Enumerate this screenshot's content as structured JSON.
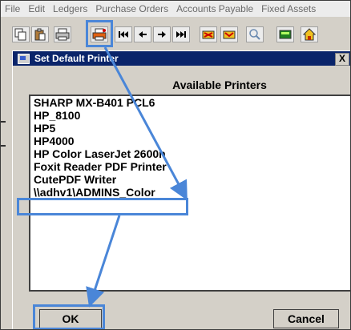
{
  "menu": {
    "items": [
      "File",
      "Edit",
      "Ledgers",
      "Purchase Orders",
      "Accounts Payable",
      "Fixed Assets"
    ]
  },
  "toolbar": {
    "icons": [
      "copy-icon",
      "paste-icon",
      "print-icon",
      "set-default-printer-icon",
      "first-record-icon",
      "previous-record-icon",
      "next-record-icon",
      "last-record-icon",
      "cross-reference-icon",
      "lookup-icon",
      "search-icon",
      "calculator-icon",
      "home-icon"
    ]
  },
  "dialog": {
    "title": "Set Default Printer",
    "close": "X",
    "list_header": "Available Printers",
    "printers": [
      "SHARP MX-B401 PCL6",
      "HP_8100",
      "HP5",
      "HP4000",
      "HP Color LaserJet 2600n",
      "Foxit Reader PDF Printer",
      "CutePDF Writer",
      "\\\\adhv1\\ADMINS_Color"
    ],
    "selected": "\\\\adhv1\\ADMINS_Color",
    "ok_label": "OK",
    "cancel_label": "Cancel"
  },
  "colors": {
    "titlebar": "#0a246a",
    "annotation": "#4a86d8",
    "dialog_bg": "#d4d0c8"
  }
}
